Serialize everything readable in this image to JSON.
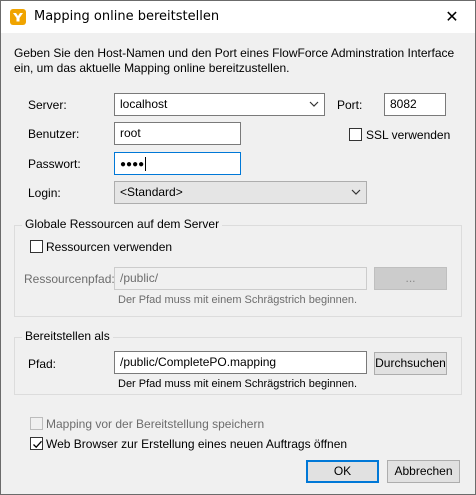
{
  "window": {
    "title": "Mapping online bereitstellen",
    "close_glyph": "✕"
  },
  "intro": "Geben Sie den Host-Namen und den Port eines FlowForce Adminstration Interface ein, um das aktuelle Mapping online bereitzustellen.",
  "server": {
    "label": "Server:",
    "value": "localhost",
    "port_label": "Port:",
    "port_value": "8082",
    "ssl_label": "SSL verwenden",
    "ssl_checked": false
  },
  "user": {
    "label": "Benutzer:",
    "value": "root"
  },
  "password": {
    "label": "Passwort:",
    "value": "●●●●"
  },
  "login": {
    "label": "Login:",
    "value": "<Standard>"
  },
  "global_resources": {
    "title": "Globale Ressourcen auf dem Server",
    "use_label": "Ressourcen verwenden",
    "use_checked": false,
    "path_label": "Ressourcenpfad:",
    "path_value": "/public/",
    "browse_label": "...",
    "hint": "Der Pfad muss mit einem Schrägstrich beginnen."
  },
  "deploy_as": {
    "title": "Bereitstellen als",
    "path_label": "Pfad:",
    "path_value": "/public/CompletePO.mapping",
    "browse_label": "Durchsuchen",
    "hint": "Der Pfad muss mit einem Schrägstrich beginnen."
  },
  "options": {
    "save_before_label": "Mapping vor der Bereitstellung speichern",
    "save_before_checked": false,
    "open_browser_label": "Web Browser zur Erstellung eines neuen Auftrags öffnen",
    "open_browser_checked": true
  },
  "buttons": {
    "ok": "OK",
    "cancel": "Abbrechen"
  },
  "colors": {
    "accent": "#0078d7",
    "app_icon": "#f0a400"
  }
}
